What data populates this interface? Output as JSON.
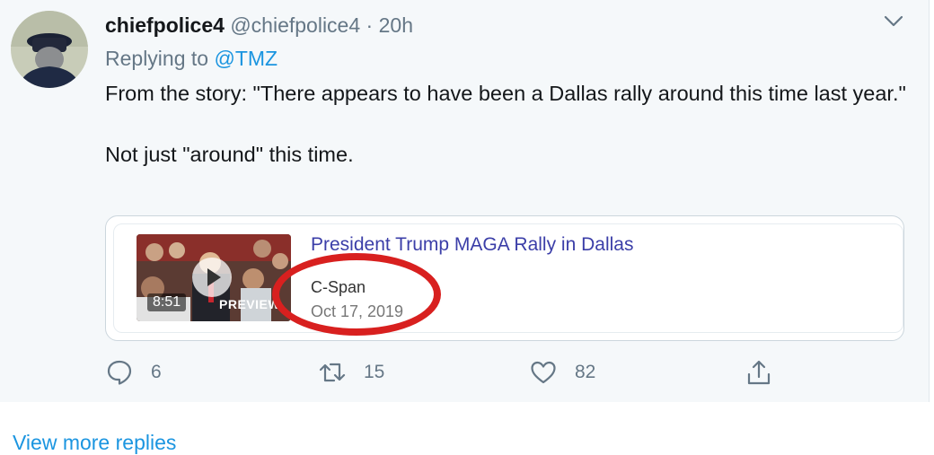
{
  "tweet": {
    "display_name": "chiefpolice4",
    "handle": "@chiefpolice4",
    "separator": "·",
    "time": "20h",
    "replying_prefix": "Replying to",
    "replying_to": "@TMZ",
    "body_line1": "From the story: \"There appears to have been a Dallas rally around this time last year.\"",
    "body_line2": "Not just \"around\" this time."
  },
  "card": {
    "title": "President Trump MAGA Rally in Dallas",
    "source": "C-Span",
    "date": "Oct 17, 2019",
    "duration": "8:51",
    "preview_label": "PREVIEW"
  },
  "actions": {
    "reply_count": "6",
    "retweet_count": "15",
    "like_count": "82"
  },
  "footer": {
    "view_more": "View more replies"
  },
  "colors": {
    "link": "#1b95e0",
    "annotation": "#d8201f",
    "card_title": "#3b3ea8"
  },
  "icons": [
    "chevron-down-icon",
    "play-icon",
    "reply-icon",
    "retweet-icon",
    "like-icon",
    "share-icon"
  ]
}
